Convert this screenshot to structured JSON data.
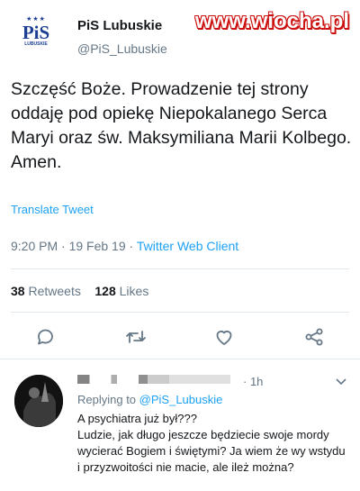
{
  "header": {
    "avatar_text": "PiS",
    "avatar_sub": "LUBUSKIE",
    "name": "PiS Lubuskie",
    "handle": "@PiS_Lubuskie"
  },
  "watermark": "www.wiocha.pl",
  "tweet": {
    "text": "Szczęść Boże. Prowadzenie tej strony oddaję pod opiekę Niepokalanego Serca Maryi oraz św. Maksymiliana Marii Kolbego. Amen.",
    "translate": "Translate Tweet",
    "time": "9:20 PM · 19 Feb 19 · ",
    "client": "Twitter Web Client",
    "retweets_count": "38",
    "retweets_label": "Retweets",
    "likes_count": "128",
    "likes_label": "Likes"
  },
  "actions": [
    "reply-icon",
    "retweet-icon",
    "like-icon",
    "share-icon"
  ],
  "reply": {
    "time": "· 1h",
    "replying_prefix": "Replying to ",
    "replying_handle": "@PiS_Lubuskie",
    "text_line1": "A psychiatra już był???",
    "text_rest": "Ludzie, jak długo jeszcze będziecie swoje mordy wycierać Bogiem i świętymi?  Ja wiem że wy wstydu i przyzwoitości nie macie, ale ileż można?"
  },
  "colors": {
    "accent": "#1da1f2",
    "muted": "#657786",
    "text": "#14171a",
    "brand": "#1c3f94",
    "watermark_outline": "#cc1111"
  }
}
